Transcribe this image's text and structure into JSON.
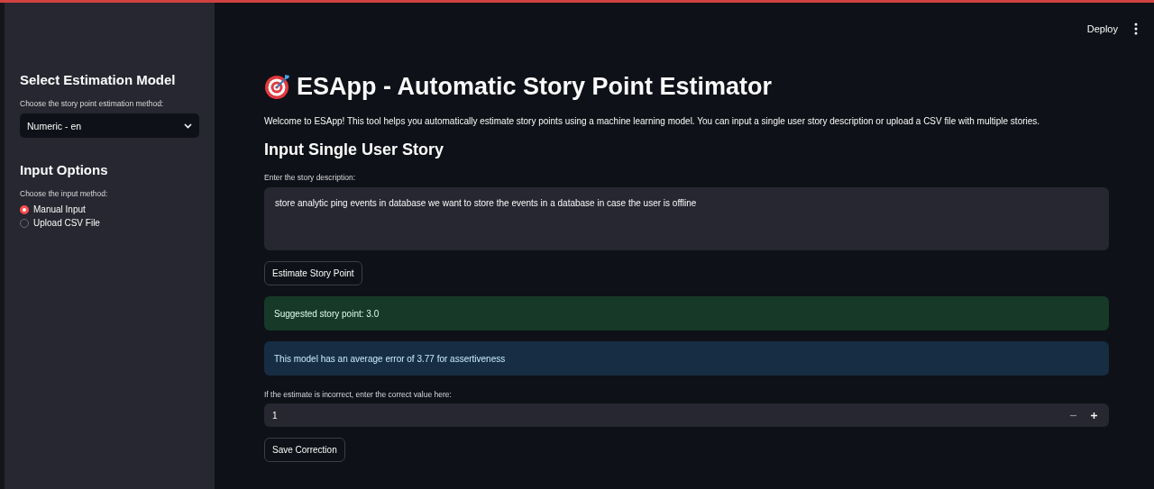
{
  "header": {
    "deploy": "Deploy"
  },
  "sidebar": {
    "model_heading": "Select Estimation Model",
    "model_label": "Choose the story point estimation method:",
    "model_select": {
      "value": "Numeric - en"
    },
    "input_heading": "Input Options",
    "input_label": "Choose the input method:",
    "input_methods": [
      {
        "label": "Manual Input",
        "selected": true
      },
      {
        "label": "Upload CSV File",
        "selected": false
      }
    ]
  },
  "main": {
    "title": "ESApp - Automatic Story Point Estimator",
    "intro": "Welcome to ESApp! This tool helps you automatically estimate story points using a machine learning model. You can input a single user story description or upload a CSV file with multiple stories.",
    "subheading": "Input Single User Story",
    "story_label": "Enter the story description:",
    "story_value": "store analytic ping events in database we want to store the events in a database in case the user is offline",
    "estimate_button": "Estimate Story Point",
    "alerts": [
      {
        "kind": "success",
        "text": "Suggested story point: 3.0"
      },
      {
        "kind": "info",
        "text": "This model has an average error of 3.77 for assertiveness"
      }
    ],
    "correction_label": "If the estimate is incorrect, enter the correct value here:",
    "correction_value": "1",
    "save_button": "Save Correction"
  }
}
